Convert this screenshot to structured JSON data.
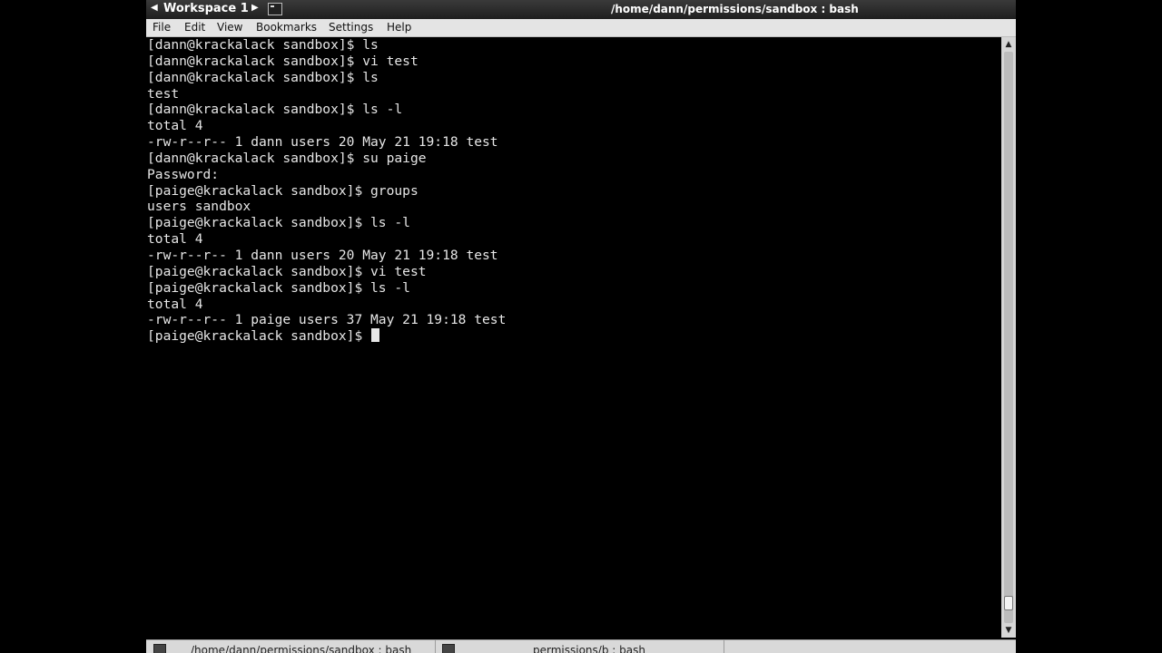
{
  "titlebar": {
    "workspace_prev_icon": "triangle-left-icon",
    "workspace_label": "Workspace 1",
    "workspace_next_icon": "triangle-right-icon",
    "window_title": "/home/dann/permissions/sandbox : bash"
  },
  "menu": {
    "items": [
      {
        "label": "File"
      },
      {
        "label": "Edit"
      },
      {
        "label": "View"
      },
      {
        "label": "Bookmarks"
      },
      {
        "label": "Settings"
      },
      {
        "label": "Help"
      }
    ]
  },
  "terminal": {
    "lines": [
      "[dann@krackalack sandbox]$ ls",
      "[dann@krackalack sandbox]$ vi test",
      "[dann@krackalack sandbox]$ ls",
      "test",
      "[dann@krackalack sandbox]$ ls -l",
      "total 4",
      "-rw-r--r-- 1 dann users 20 May 21 19:18 test",
      "[dann@krackalack sandbox]$ su paige",
      "Password:",
      "[paige@krackalack sandbox]$ groups",
      "users sandbox",
      "[paige@krackalack sandbox]$ ls -l",
      "total 4",
      "-rw-r--r-- 1 dann users 20 May 21 19:18 test",
      "[paige@krackalack sandbox]$ vi test",
      "[paige@krackalack sandbox]$ ls -l",
      "total 4",
      "-rw-r--r-- 1 paige users 37 May 21 19:18 test"
    ],
    "prompt": "[paige@krackalack sandbox]$ "
  },
  "taskbar": {
    "tasks": [
      {
        "label": "/home/dann/permissions/sandbox : bash"
      },
      {
        "label": "permissions/b : bash"
      }
    ]
  },
  "colors": {
    "terminal_bg": "#000000",
    "terminal_fg": "#e6e6e6",
    "titlebar_bg": "#2b2b2b",
    "menubar_bg": "#e4e4e4"
  }
}
